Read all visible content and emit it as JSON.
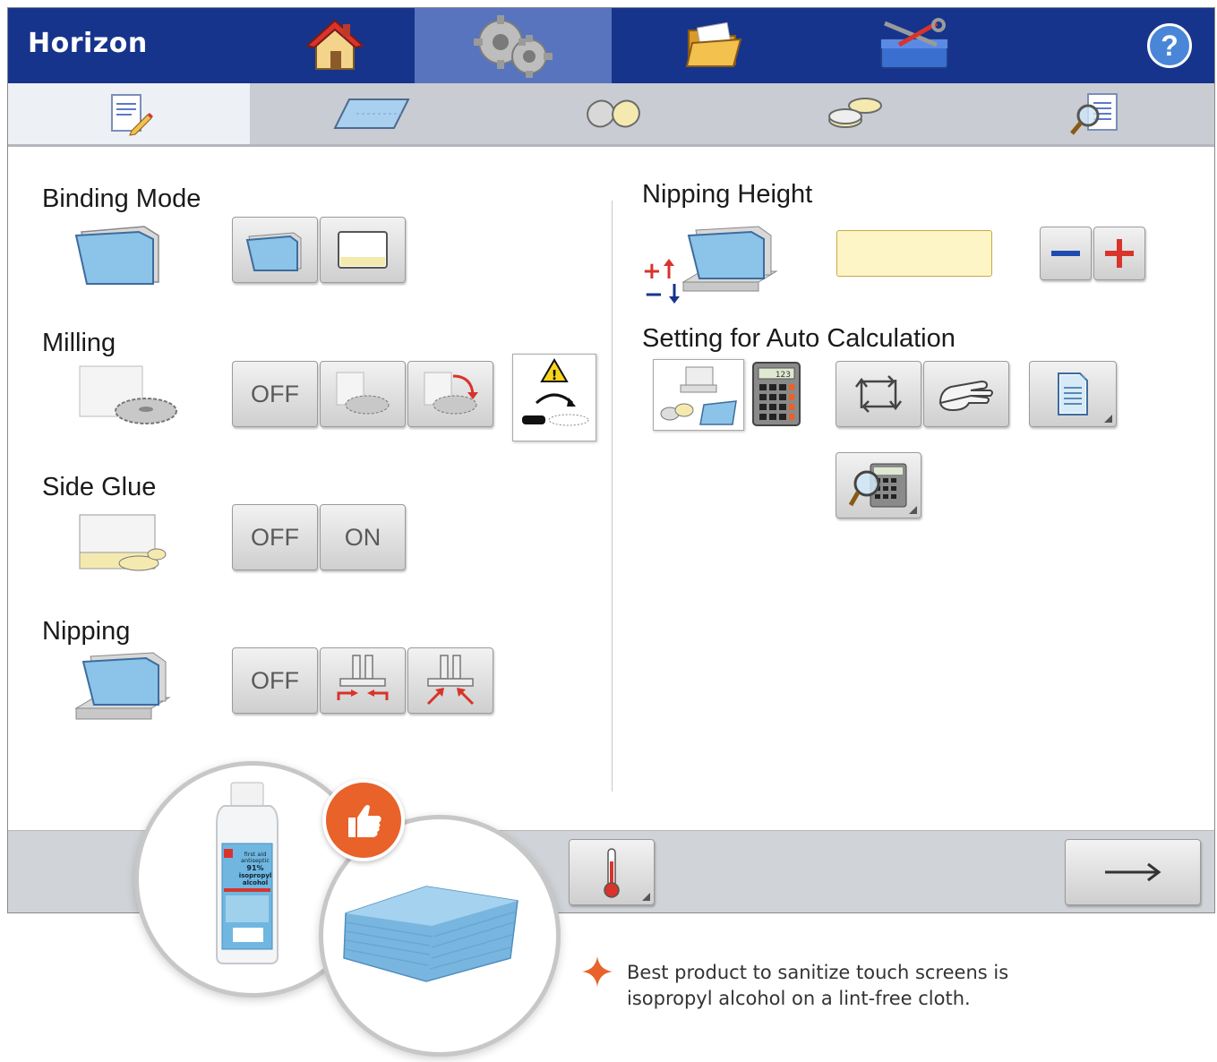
{
  "app": {
    "brand": "Horizon"
  },
  "top_nav": [
    {
      "name": "home-icon"
    },
    {
      "name": "gears-icon",
      "active": true
    },
    {
      "name": "folder-icon"
    },
    {
      "name": "toolbox-icon"
    },
    {
      "name": "help-icon",
      "label": "?"
    }
  ],
  "sub_tabs": [
    {
      "name": "edit-document-icon",
      "active": true
    },
    {
      "name": "sheet-icon"
    },
    {
      "name": "rollers-icon"
    },
    {
      "name": "glue-pots-icon"
    },
    {
      "name": "preview-icon"
    }
  ],
  "left": {
    "binding_mode": {
      "label": "Binding Mode",
      "options": [
        "book-cover-icon",
        "padding-icon"
      ]
    },
    "milling": {
      "label": "Milling",
      "options": [
        "OFF",
        "milling-icon",
        "milling-rotate-icon"
      ],
      "warning_icon": "warning-icon"
    },
    "side_glue": {
      "label": "Side Glue",
      "options": [
        "OFF",
        "ON"
      ]
    },
    "nipping": {
      "label": "Nipping",
      "options": [
        "OFF",
        "nipping-parallel-icon",
        "nipping-angled-icon"
      ]
    }
  },
  "right": {
    "nipping_height": {
      "label": "Nipping Height",
      "value": "",
      "minus": "−",
      "plus": "+"
    },
    "auto_calc": {
      "label": "Setting for Auto Calculation",
      "calculator_display": "123"
    }
  },
  "bottom": {
    "temperature_icon": "thermometer-icon",
    "next_icon": "arrow-right-icon"
  },
  "overlay": {
    "bottle_label_lines": [
      "first aid",
      "antiseptic",
      "91%",
      "isopropyl",
      "alcohol"
    ],
    "tip_line1": "Best product to sanitize touch screens is",
    "tip_line2": "isopropyl alcohol on a lint-free cloth."
  },
  "colors": {
    "top_bar": "#17348c",
    "active_tab": "#5874be",
    "accent_orange": "#e8622a",
    "cloth_blue": "#8cc3e8"
  }
}
